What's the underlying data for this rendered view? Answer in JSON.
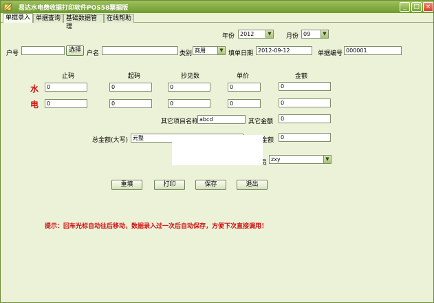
{
  "window": {
    "title": "易达水电费收据打印软件POS58票据版",
    "colors": {
      "title_bar": "#7fa83d",
      "body": "#ecf2d8",
      "hint": "#d01010"
    }
  },
  "title_buttons": {
    "minimize": "_",
    "maximize": "□",
    "close": "×"
  },
  "tabs": [
    {
      "label": "单据录入"
    },
    {
      "label": "单据查询"
    },
    {
      "label": "基础数据管理"
    },
    {
      "label": "在线帮助"
    }
  ],
  "period": {
    "year_label": "年份",
    "year_value": "2012",
    "month_label": "月份",
    "month_value": "09"
  },
  "header": {
    "account_label": "户号",
    "account_value": "",
    "select_button": "选择",
    "name_label": "户名",
    "name_value": "",
    "category_label": "类别",
    "category_value": "商用",
    "date_label": "填单日期",
    "date_value": "2012-09-12",
    "bill_no_label": "单据编号",
    "bill_no_value": "000001"
  },
  "grid": {
    "columns": [
      "止码",
      "起码",
      "抄见数",
      "单价",
      "金额"
    ],
    "rows": [
      {
        "label": "水",
        "values": [
          "0",
          "0",
          "0",
          "0",
          "0"
        ]
      },
      {
        "label": "电",
        "values": [
          "0",
          "0",
          "0",
          "0",
          "0"
        ]
      }
    ]
  },
  "other": {
    "item_name_label": "其它项目名称",
    "item_name_value": "abcd",
    "amount_label": "其它金额",
    "amount_value": "0"
  },
  "total": {
    "caps_label": "总金额(大写)",
    "caps_value": "元整",
    "amount_label_partial": "总金额",
    "amount_value": "0"
  },
  "operator": {
    "label_partial": "员",
    "value": "zxy"
  },
  "actions": {
    "reset": "重填",
    "print": "打印",
    "save": "保存",
    "exit": "退出"
  },
  "hint": "提示：回车光标自动往后移动，数据录入过一次后自动保存，方便下次直接调用！"
}
